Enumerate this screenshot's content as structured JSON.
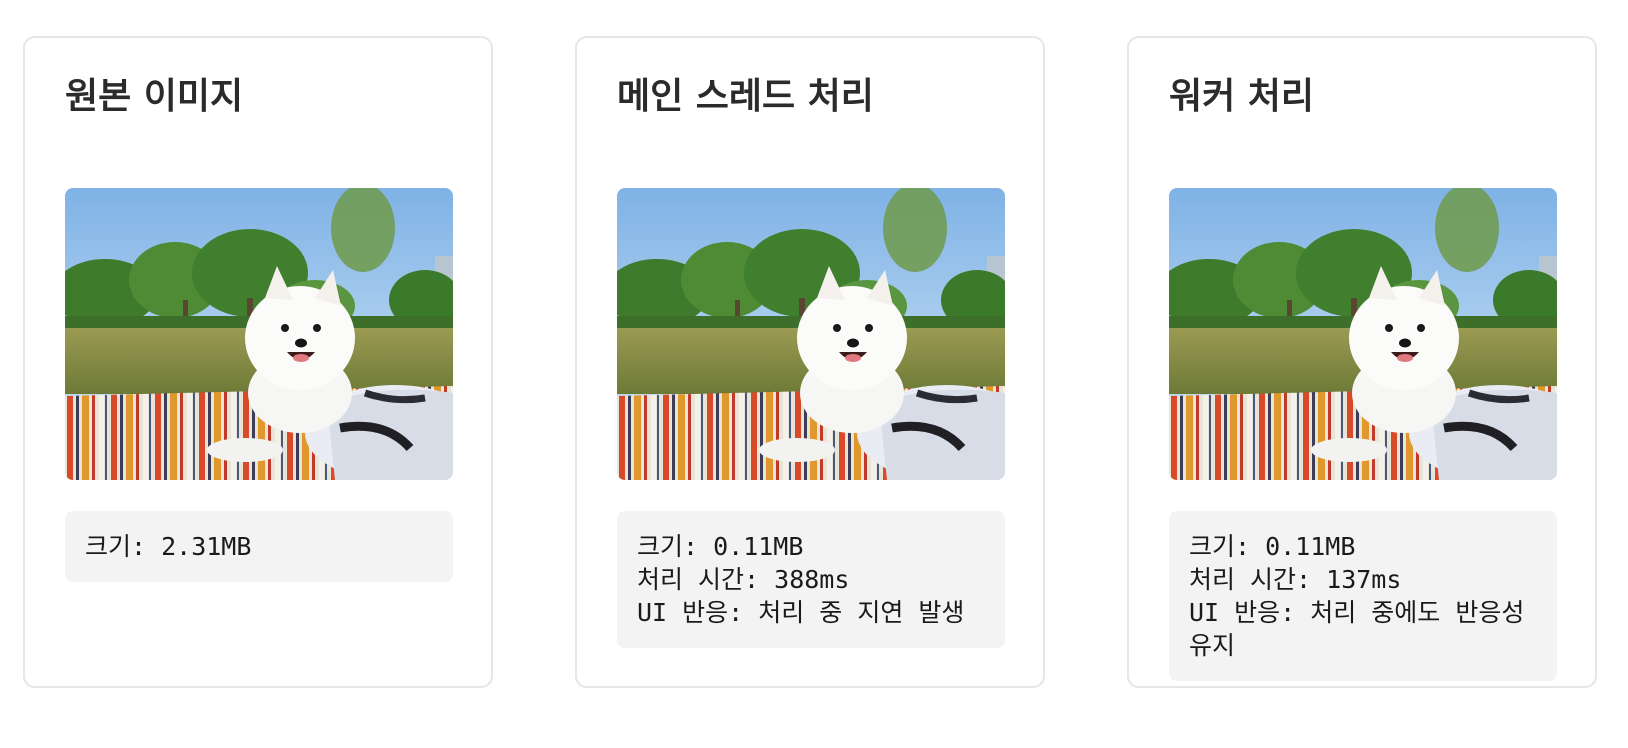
{
  "cards": [
    {
      "title": "원본 이미지",
      "image_alt": "Pomeranian on picnic blanket",
      "info": {
        "size": "크기: 2.31MB"
      }
    },
    {
      "title": "메인 스레드 처리",
      "image_alt": "Pomeranian on picnic blanket",
      "info": {
        "size": "크기: 0.11MB",
        "time": "처리 시간: 388ms",
        "ui": "UI 반응: 처리 중 지연 발생"
      }
    },
    {
      "title": "워커 처리",
      "image_alt": "Pomeranian on picnic blanket",
      "info": {
        "size": "크기: 0.11MB",
        "time": "처리 시간: 137ms",
        "ui": "UI 반응: 처리 중에도 반응성 유지"
      }
    }
  ]
}
